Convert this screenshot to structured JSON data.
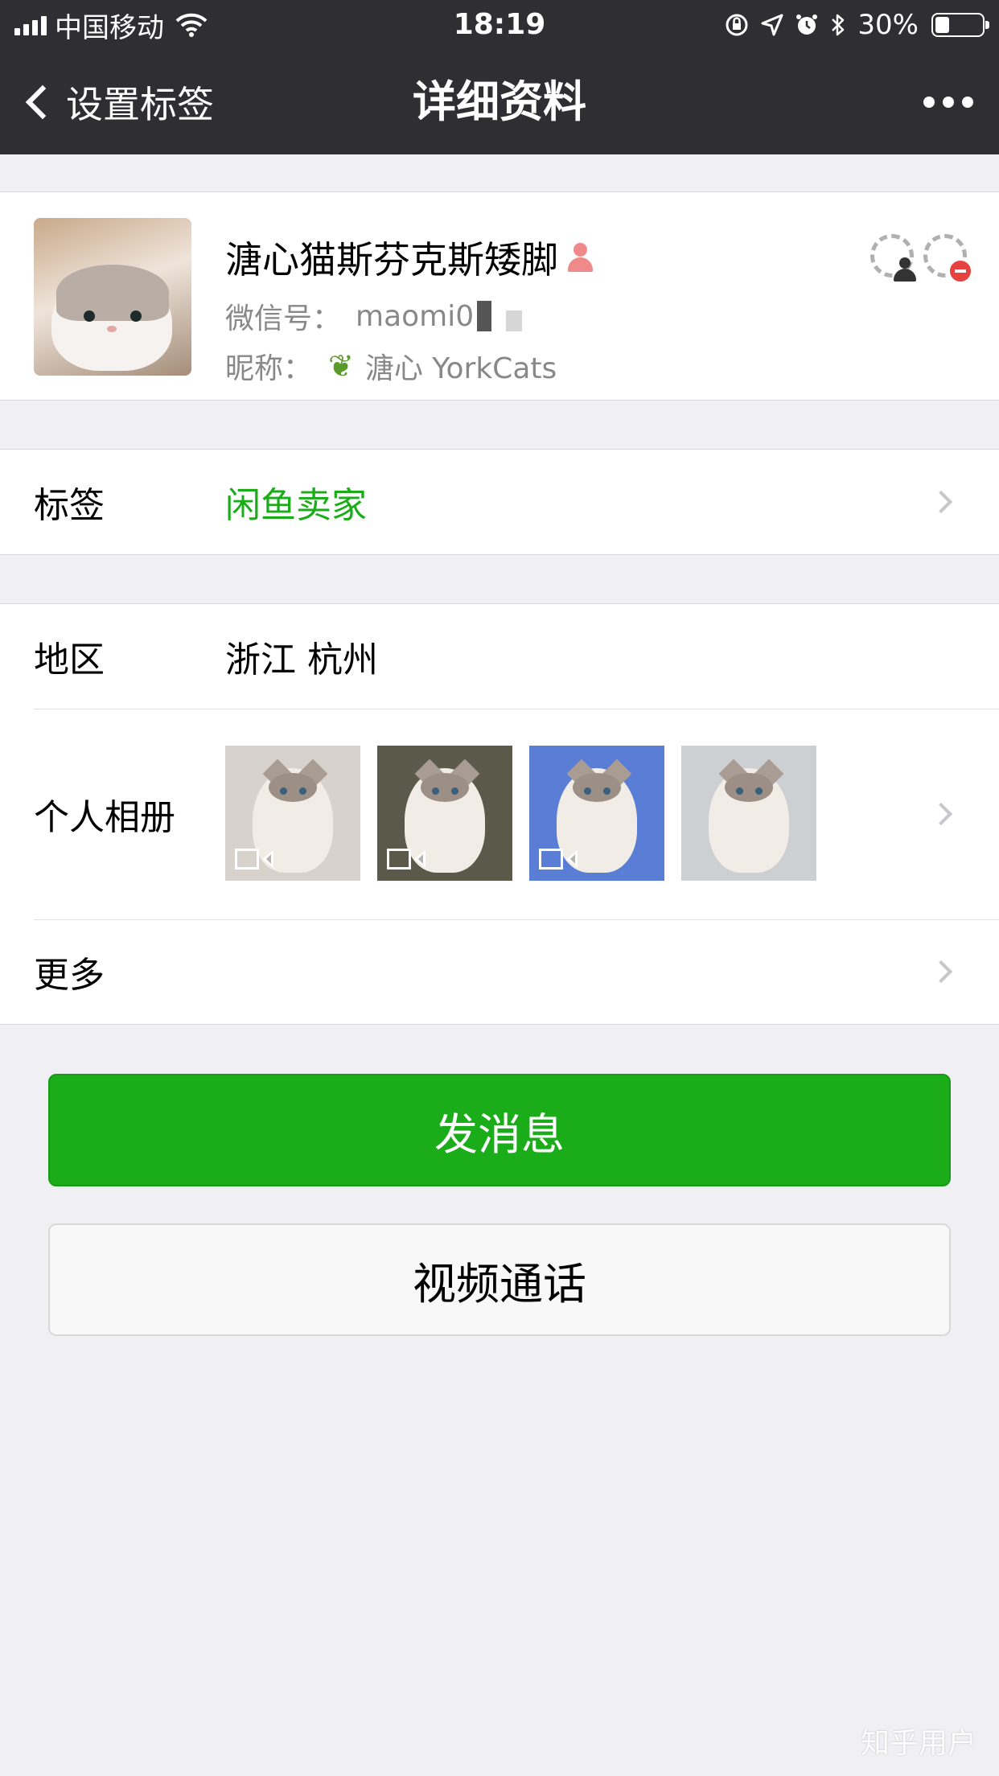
{
  "status_bar": {
    "carrier": "中国移动",
    "time": "18:19",
    "battery_percent_text": "30%",
    "battery_level": 0.3
  },
  "nav": {
    "back_label": "设置标签",
    "title": "详细资料"
  },
  "profile": {
    "name": "溏心猫斯芬克斯矮脚",
    "wechat_id_label": "微信号：",
    "wechat_id_value": "maomi0",
    "nickname_label": "昵称：",
    "nickname_value": "溏心 YorkCats",
    "gender_icon": "female-icon"
  },
  "tags_row": {
    "label": "标签",
    "value": "闲鱼卖家",
    "value_color": "#1aad19"
  },
  "region_row": {
    "label": "地区",
    "value": "浙江 杭州"
  },
  "album_row": {
    "label": "个人相册",
    "thumbnails": [
      {
        "has_video": true,
        "bg": "#d8d2cc"
      },
      {
        "has_video": true,
        "bg": "#5b5a4a"
      },
      {
        "has_video": true,
        "bg": "#5a7ed6"
      },
      {
        "has_video": false,
        "bg": "#cdd0d3"
      }
    ]
  },
  "more_row": {
    "label": "更多"
  },
  "buttons": {
    "send_message": "发消息",
    "video_call": "视频通话"
  },
  "watermark": "知乎用户",
  "colors": {
    "nav_bg": "#2e2e33",
    "primary_green": "#1aad19",
    "page_bg": "#efeff4"
  }
}
